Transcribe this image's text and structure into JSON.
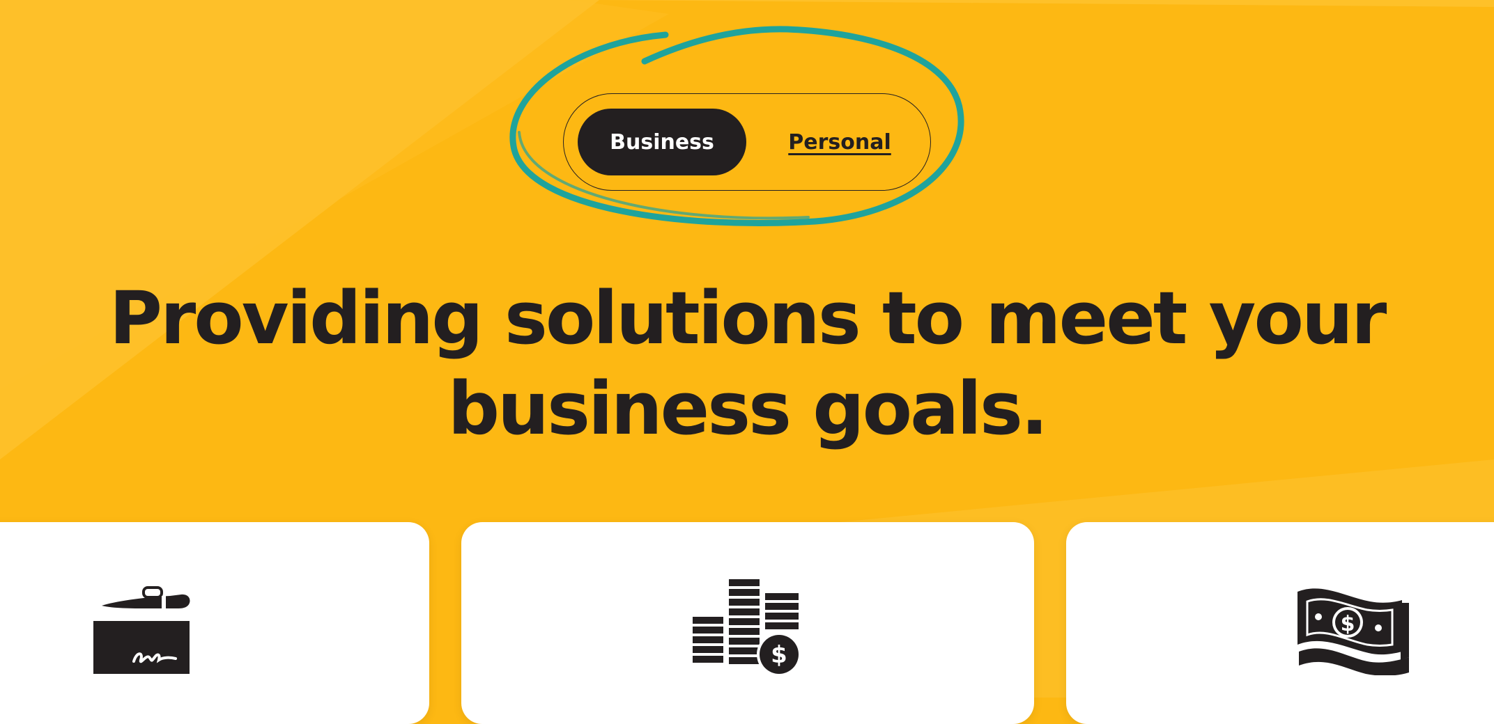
{
  "page": {
    "background_color": "#FDB813",
    "annotation_color": "#1FA39C"
  },
  "audience_toggle": {
    "options": [
      {
        "label": "Business",
        "selected": true
      },
      {
        "label": "Personal",
        "selected": false
      }
    ]
  },
  "hero": {
    "headline_line_1": "Providing solutions to meet your",
    "headline_line_2": "business goals."
  },
  "feature_cards": [
    {
      "icon": "check-signing-icon"
    },
    {
      "icon": "coin-stacks-dollar-icon"
    },
    {
      "icon": "dollar-bill-icon"
    }
  ]
}
